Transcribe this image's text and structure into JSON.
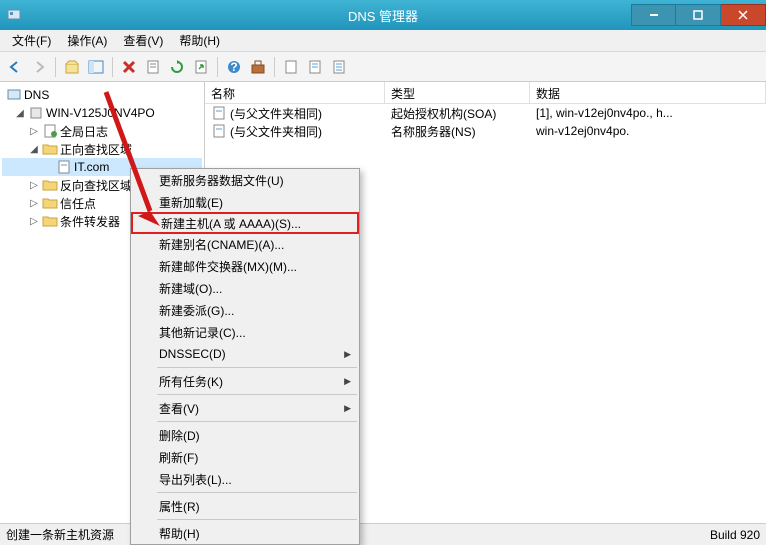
{
  "titlebar": {
    "title": "DNS 管理器"
  },
  "menu": {
    "file": "文件(F)",
    "action": "操作(A)",
    "view": "查看(V)",
    "help": "帮助(H)"
  },
  "tree": {
    "root": "DNS",
    "server": "WIN-V125J0NV4PO",
    "global_log": "全局日志",
    "fwd_zones": "正向查找区域",
    "zone": "IT.com",
    "rev_zones": "反向查找区域",
    "trust_points": "信任点",
    "cond_fwd": "条件转发器"
  },
  "columns": {
    "name": "名称",
    "type": "类型",
    "data": "数据"
  },
  "rows": [
    {
      "name": "(与父文件夹相同)",
      "type": "起始授权机构(SOA)",
      "data": "[1], win-v12ej0nv4po., h..."
    },
    {
      "name": "(与父文件夹相同)",
      "type": "名称服务器(NS)",
      "data": "win-v12ej0nv4po."
    }
  ],
  "ctx": {
    "update_server": "更新服务器数据文件(U)",
    "reload": "重新加载(E)",
    "new_host": "新建主机(A 或 AAAA)(S)...",
    "new_cname": "新建别名(CNAME)(A)...",
    "new_mx": "新建邮件交换器(MX)(M)...",
    "new_domain": "新建域(O)...",
    "new_delegation": "新建委派(G)...",
    "other_records": "其他新记录(C)...",
    "dnssec": "DNSSEC(D)",
    "all_tasks": "所有任务(K)",
    "view": "查看(V)",
    "delete": "删除(D)",
    "refresh": "刷新(F)",
    "export": "导出列表(L)...",
    "properties": "属性(R)",
    "help": "帮助(H)"
  },
  "status": {
    "left": "创建一条新主机资源",
    "right": "Build 920"
  }
}
